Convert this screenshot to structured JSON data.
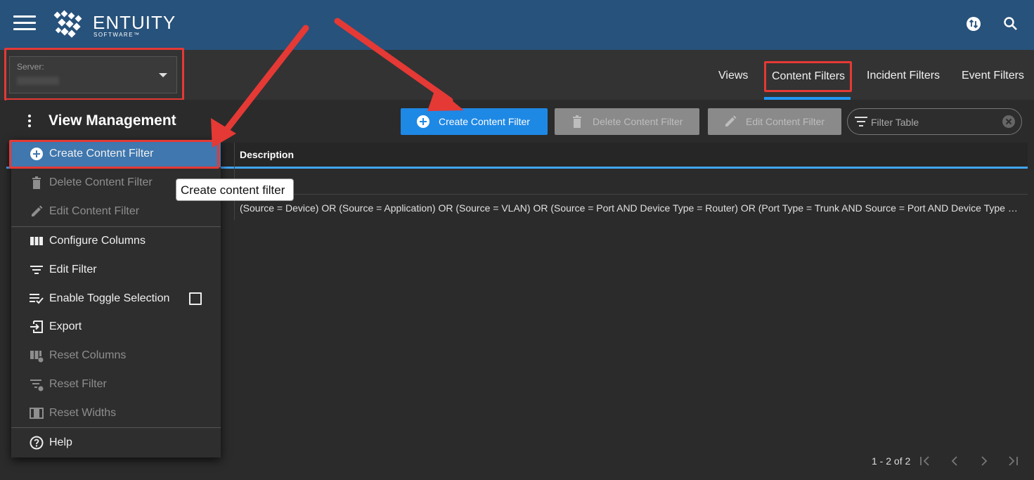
{
  "app": {
    "brand_name": "ENTUITY",
    "brand_sub": "SOFTWARE™",
    "accent_color": "#27527b",
    "primary_color": "#1e88e5",
    "annotation_color": "#e53935"
  },
  "topbar": {
    "menu_icon": "hamburger-icon",
    "icons": [
      "sync-icon",
      "search-icon"
    ]
  },
  "server": {
    "label": "Server:",
    "value": ""
  },
  "tabs": [
    {
      "label": "Views",
      "active": false
    },
    {
      "label": "Content Filters",
      "active": true
    },
    {
      "label": "Incident Filters",
      "active": false
    },
    {
      "label": "Event Filters",
      "active": false
    }
  ],
  "page": {
    "title": "View Management"
  },
  "toolbar": {
    "create_label": "Create Content Filter",
    "delete_label": "Delete Content Filter",
    "edit_label": "Edit Content Filter",
    "filter_placeholder": "Filter Table"
  },
  "table": {
    "columns": [
      "Description"
    ],
    "rows": [
      "",
      "(Source = Device) OR (Source = Application) OR (Source = VLAN) OR (Source = Port AND Device Type = Router) OR (Port Type = Trunk AND Source = Port AND Device Type = ..."
    ]
  },
  "pagination": {
    "range_text": "1 - 2 of 2"
  },
  "menu": {
    "items": [
      {
        "label": "Create Content Filter",
        "icon": "add-circle-icon",
        "state": "active"
      },
      {
        "label": "Delete Content Filter",
        "icon": "trash-icon",
        "state": "disabled"
      },
      {
        "label": "Edit Content Filter",
        "icon": "pencil-icon",
        "state": "disabled"
      },
      {
        "label": "Configure Columns",
        "icon": "columns-icon",
        "state": "enabled"
      },
      {
        "label": "Edit Filter",
        "icon": "filter-icon",
        "state": "enabled"
      },
      {
        "label": "Enable Toggle Selection",
        "icon": "list-check-icon",
        "state": "enabled",
        "checked": false
      },
      {
        "label": "Export",
        "icon": "export-icon",
        "state": "enabled"
      },
      {
        "label": "Reset Columns",
        "icon": "reset-columns-icon",
        "state": "disabled"
      },
      {
        "label": "Reset Filter",
        "icon": "reset-filter-icon",
        "state": "disabled"
      },
      {
        "label": "Reset Widths",
        "icon": "reset-widths-icon",
        "state": "disabled"
      },
      {
        "label": "Help",
        "icon": "help-icon",
        "state": "enabled"
      }
    ]
  },
  "tooltip": {
    "text": "Create content filter"
  }
}
